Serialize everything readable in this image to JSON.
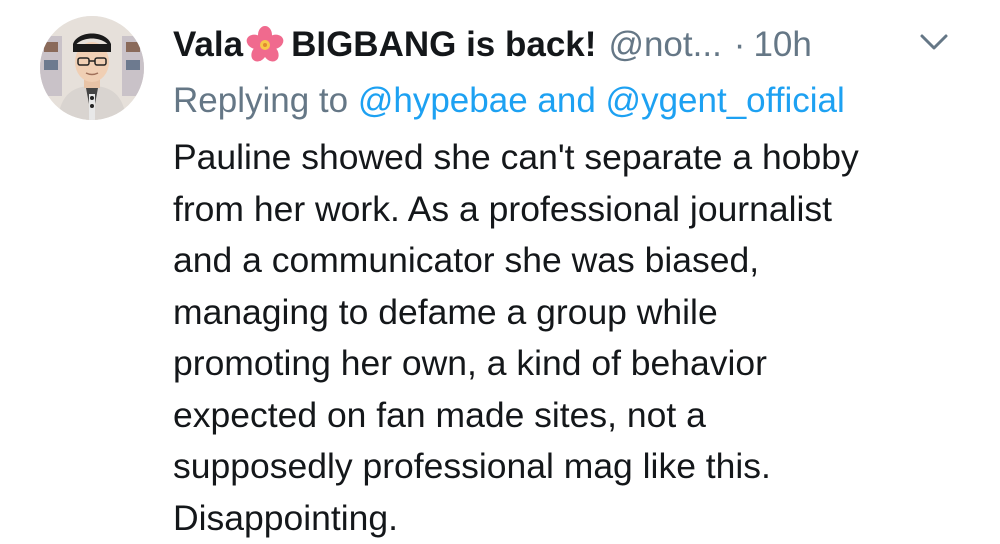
{
  "tweet": {
    "display_name": "Vala",
    "display_name_suffix": "BIGBANG is back!",
    "name_emoji": "cherry-blossom-icon",
    "handle": "@not...",
    "separator": "·",
    "time": "10h",
    "reply": {
      "prefix": "Replying to",
      "mention_1": "@hypebae",
      "conjunction": "and",
      "mention_2": "@ygent_official"
    },
    "body_lines": [
      "Pauline showed she can't separate a hobby",
      "from her work. As a professional journalist",
      "and a communicator she was biased,",
      "managing to defame a group while",
      "promoting her own, a kind of behavior",
      "expected on fan made sites, not a",
      "supposedly professional mag like this.",
      "Disappointing."
    ]
  },
  "colors": {
    "text": "#14171a",
    "secondary": "#657786",
    "link": "#1da1f2",
    "emoji_petal": "#f06a8e",
    "emoji_center": "#f7c948"
  }
}
